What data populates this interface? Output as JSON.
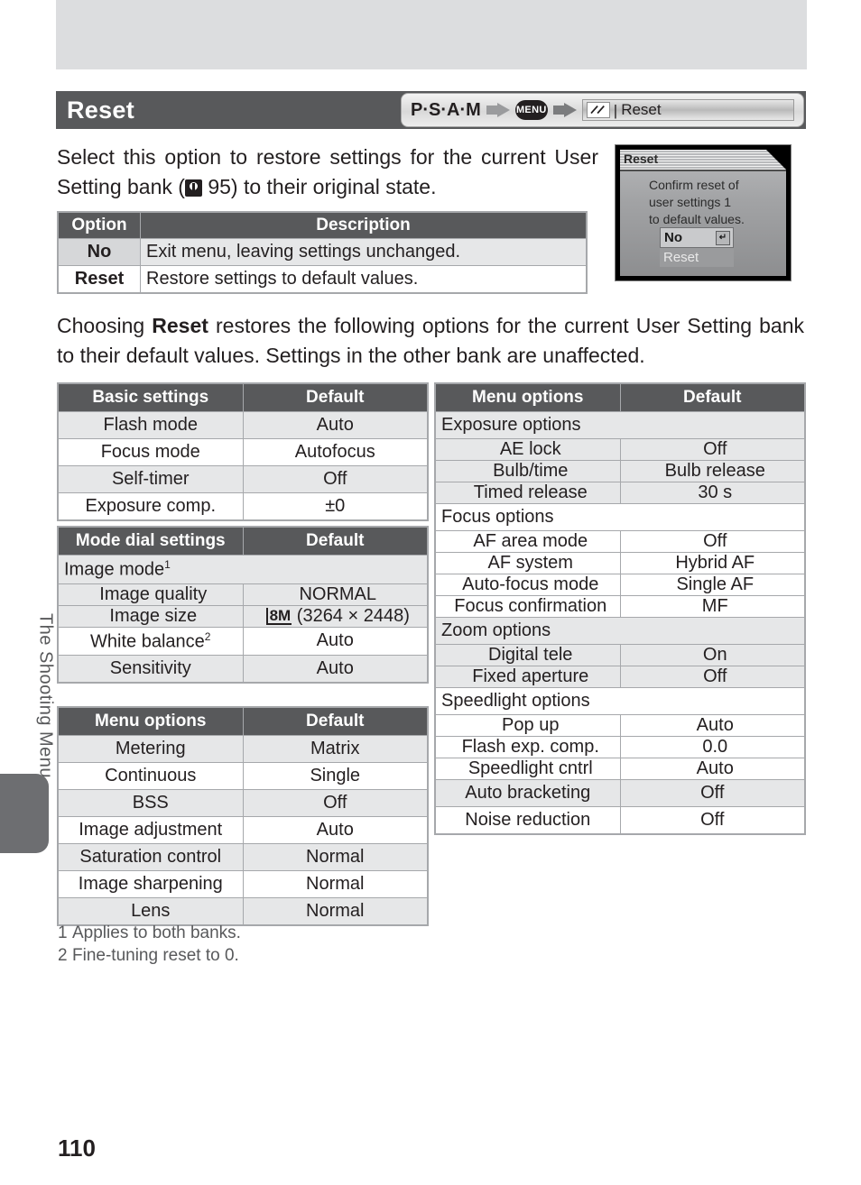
{
  "page": {
    "number": "110",
    "side_label": "The Shooting Menu"
  },
  "header": {
    "title": "Reset",
    "breadcrumb": {
      "modes": "P·S·A·M",
      "menu_badge": "MENU",
      "item_label": "Reset",
      "separator": "|",
      "arrow_icon": "arrow-right-icon",
      "slash_icon": "shooting-menu-icon"
    }
  },
  "intro": {
    "part1": "Select this option to restore settings for the current User Setting bank (",
    "ref_icon": "page-reference-icon",
    "ref_page": "95",
    "part2": ") to their original state."
  },
  "option_table": {
    "headers": [
      "Option",
      "Description"
    ],
    "rows": [
      {
        "option": "No",
        "description": "Exit menu, leaving settings unchanged."
      },
      {
        "option": "Reset",
        "description": "Restore settings to default values."
      }
    ]
  },
  "lcd": {
    "title": "Reset",
    "message_lines": [
      "Confirm reset of",
      "user settings 1",
      "to default values."
    ],
    "options": [
      {
        "label": "No",
        "selected": true,
        "enter_icon": "↵"
      },
      {
        "label": "Reset",
        "selected": false
      }
    ]
  },
  "paragraph2": {
    "before": "Choosing ",
    "bold": "Reset",
    "after": " restores the following options for the current User Setting bank to their default values.  Settings in the other bank are unaffected."
  },
  "tables": {
    "basic": {
      "headers": [
        "Basic settings",
        "Default"
      ],
      "rows": [
        {
          "name": "Flash mode",
          "value": "Auto",
          "shade": true
        },
        {
          "name": "Focus mode",
          "value": "Autofocus",
          "shade": false
        },
        {
          "name": "Self-timer",
          "value": "Off",
          "shade": true
        },
        {
          "name": "Exposure comp.",
          "value": "±0",
          "shade": false
        }
      ]
    },
    "mode_dial": {
      "headers": [
        "Mode dial settings",
        "Default"
      ],
      "group": {
        "label": "Image mode",
        "footnote": "1"
      },
      "group_rows": [
        {
          "name": "Image quality",
          "value": "NORMAL"
        },
        {
          "name": "Image size",
          "value_badge": "8M",
          "value": "(3264 × 2448)"
        }
      ],
      "rows": [
        {
          "name": "White balance",
          "footnote": "2",
          "value": "Auto",
          "shade": false
        },
        {
          "name": "Sensitivity",
          "value": "Auto",
          "shade": true
        }
      ]
    },
    "menu_left": {
      "headers": [
        "Menu options",
        "Default"
      ],
      "rows": [
        {
          "name": "Metering",
          "value": "Matrix",
          "shade": true
        },
        {
          "name": "Continuous",
          "value": "Single",
          "shade": false
        },
        {
          "name": "BSS",
          "value": "Off",
          "shade": true
        },
        {
          "name": "Image adjustment",
          "value": "Auto",
          "shade": false
        },
        {
          "name": "Saturation control",
          "value": "Normal",
          "shade": true
        },
        {
          "name": "Image sharpening",
          "value": "Normal",
          "shade": false
        },
        {
          "name": "Lens",
          "value": "Normal",
          "shade": true
        }
      ]
    },
    "menu_right": {
      "headers": [
        "Menu options",
        "Default"
      ],
      "groups": [
        {
          "label": "Exposure options",
          "shade": true,
          "rows": [
            {
              "name": "AE lock",
              "value": "Off"
            },
            {
              "name": "Bulb/time",
              "value": "Bulb release"
            },
            {
              "name": "Timed release",
              "value": "30 s"
            }
          ]
        },
        {
          "label": "Focus options",
          "shade": false,
          "rows": [
            {
              "name": "AF area mode",
              "value": "Off"
            },
            {
              "name": "AF system",
              "value": "Hybrid AF"
            },
            {
              "name": "Auto-focus mode",
              "value": "Single AF"
            },
            {
              "name": "Focus confirmation",
              "value": "MF"
            }
          ]
        },
        {
          "label": "Zoom options",
          "shade": true,
          "rows": [
            {
              "name": "Digital tele",
              "value": "On"
            },
            {
              "name": "Fixed aperture",
              "value": "Off"
            }
          ]
        },
        {
          "label": "Speedlight options",
          "shade": false,
          "rows": [
            {
              "name": "Pop up",
              "value": "Auto"
            },
            {
              "name": "Flash exp. comp.",
              "value": "0.0"
            },
            {
              "name": "Speedlight cntrl",
              "value": "Auto"
            }
          ]
        }
      ],
      "tail_rows": [
        {
          "name": "Auto bracketing",
          "value": "Off",
          "shade": true
        },
        {
          "name": "Noise reduction",
          "value": "Off",
          "shade": false
        }
      ]
    }
  },
  "footnotes": [
    {
      "num": "1",
      "text": "Applies to both banks."
    },
    {
      "num": "2",
      "text": "Fine-tuning reset to 0."
    }
  ]
}
